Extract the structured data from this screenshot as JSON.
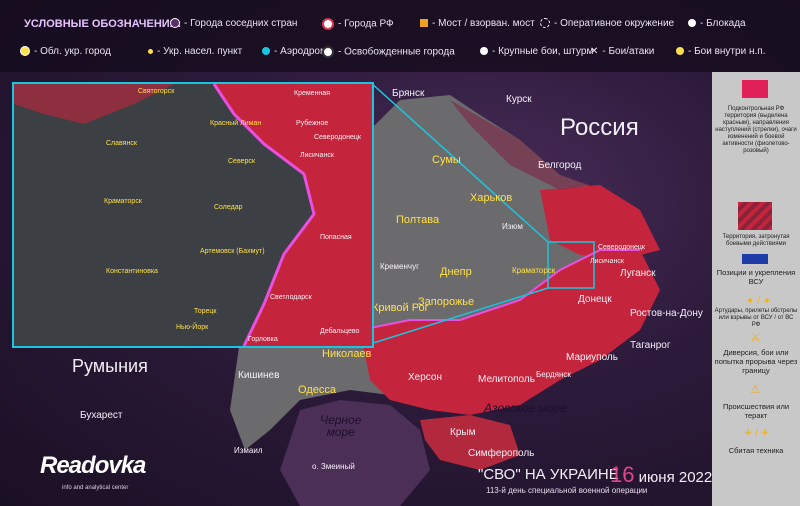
{
  "legend": {
    "title": "УСЛОВНЫЕ ОБОЗНАЧЕНИЯ:",
    "items": [
      "- Города соседних стран",
      "- Города РФ",
      "- Мост / взорван. мост",
      "- Оперативное окружение",
      "- Блокада",
      "- Обл. укр. город",
      "- Укр. насел. пункт",
      "- Аэродром",
      "- Освобожденные города",
      "- Крупные бои, штурм",
      "- Бои/атаки",
      "- Бои внутри н.п."
    ]
  },
  "colors": {
    "russia_territory": "#c5253c",
    "ukraine_territory": "#6b6b6d",
    "frontline": "#e94fe0",
    "inset_border": "#19c6df",
    "background": "#2c1a3a"
  },
  "labels": {
    "russia": "Россия",
    "romania": "Румыния",
    "black_sea": "Черное\nморе",
    "azov_sea": "Азовское море",
    "bucharest": "Бухарест",
    "crimea": "Крым"
  },
  "cities_ru": [
    "Курск",
    "Белгород",
    "Ростов-на-Дону",
    "Таганрог",
    "Брянск"
  ],
  "cities_ua": [
    "Сумы",
    "Харьков",
    "Полтава",
    "Днепр",
    "Запорожье",
    "Кривой Рог",
    "Николаев",
    "Одесса",
    "Херсон",
    "Мелитополь",
    "Мариуполь",
    "Луганск",
    "Донецк",
    "Краматорск",
    "Северодонецк",
    "Лисичанск",
    "Изюм",
    "Кременчуг",
    "Симферополь",
    "Кишинев",
    "Бердянск",
    "Измаил",
    "о. Змеиный"
  ],
  "side_legend": [
    "Подконтрольная РФ территория (выделена красным), направления наступлений (стрелки), очаги изменений и боевой активности (фиолетово-розовый)",
    "Территория, затронутая боевыми действиями",
    "Позиции и укрепления ВСУ",
    "Артудары, прилеты обстрелы или взрывы от ВСУ / от ВС РФ",
    "Диверсия, бои или попытка прорыва через границу",
    "Происшествия или теракт",
    "Сбитая техника"
  ],
  "footer": {
    "title": "\"СВО\" НА УКРАИНЕ",
    "day": "16",
    "month_year": "июня 2022",
    "subtitle": "113-й день специальной военной операции"
  },
  "logo": {
    "name": "Readovka",
    "tagline": "info and analytical center"
  },
  "inset": {
    "labels": [
      "Святогорск",
      "Кременная",
      "Красный Лиман",
      "Рубежное",
      "Славянск",
      "Северск",
      "Лисичанск",
      "Северодонецк",
      "Краматорск",
      "Соледар",
      "Артемовск (Бахмут)",
      "Попасная",
      "Константиновка",
      "Светлодарск",
      "Торецк",
      "Нью-Йорк",
      "Горловка",
      "Дебальцево"
    ]
  }
}
